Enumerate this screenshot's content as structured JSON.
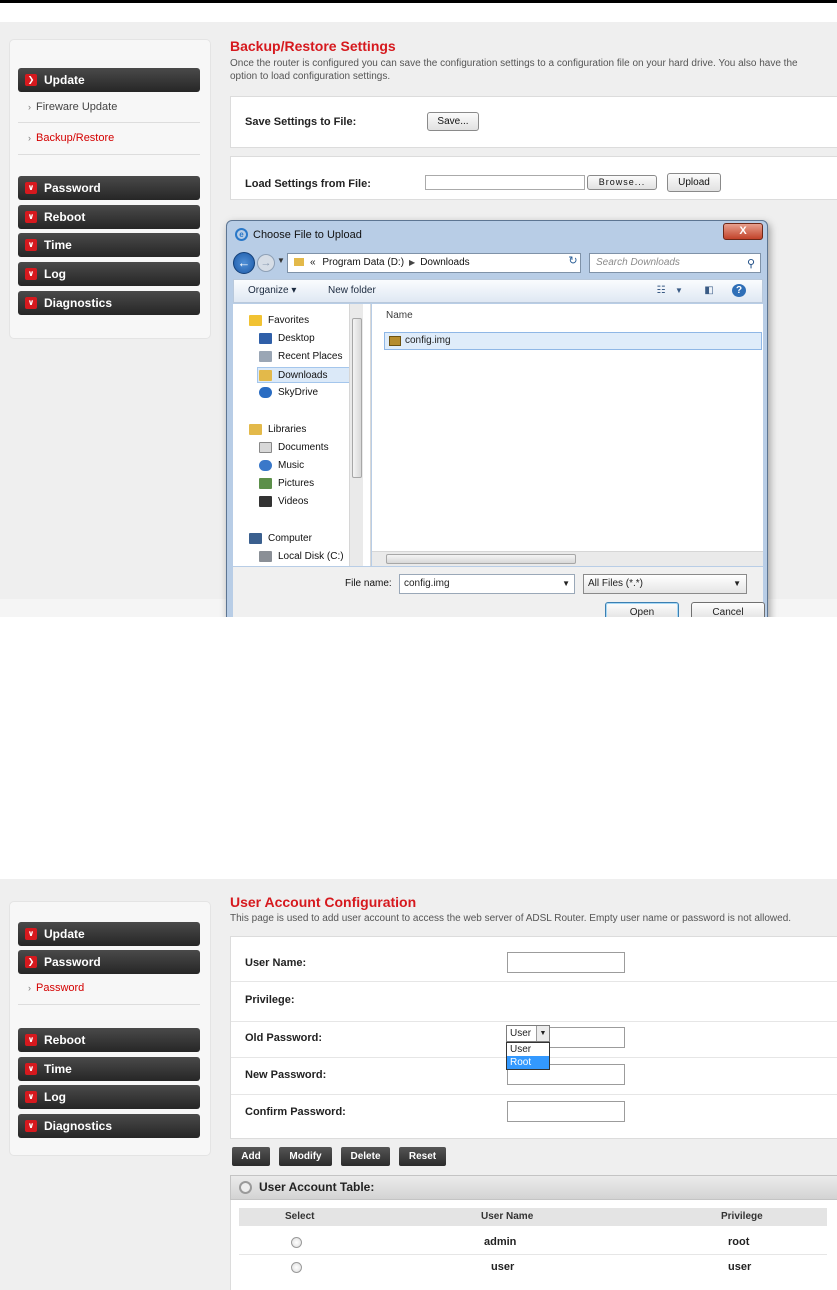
{
  "backup": {
    "sidebar": {
      "update": "Update",
      "firmware_update": "Fireware Update",
      "backup_restore": "Backup/Restore",
      "password": "Password",
      "reboot": "Reboot",
      "time": "Time",
      "log": "Log",
      "diagnostics": "Diagnostics"
    },
    "title": "Backup/Restore Settings",
    "description": "Once the router is configured you can save the configuration settings to a configuration file on your hard drive. You also have the option to load configuration settings.",
    "save_label": "Save Settings to File:",
    "save_button": "Save...",
    "load_label": "Load Settings from File:",
    "browse_button": "Browse...",
    "upload_button": "Upload",
    "dialog": {
      "title": "Choose File to Upload",
      "close": "X",
      "breadcrumb_prefix": "«",
      "breadcrumb_drive": "Program Data (D:)",
      "breadcrumb_folder": "Downloads",
      "search_placeholder": "Search Downloads",
      "organize": "Organize ▾",
      "new_folder": "New folder",
      "favorites": "Favorites",
      "desktop": "Desktop",
      "recent_places": "Recent Places",
      "downloads": "Downloads",
      "skydrive": "SkyDrive",
      "libraries": "Libraries",
      "documents": "Documents",
      "music": "Music",
      "pictures": "Pictures",
      "videos": "Videos",
      "computer": "Computer",
      "local_disk": "Local Disk (C:)",
      "column_name": "Name",
      "file_item": "config.img",
      "file_name_label": "File name:",
      "file_name_value": "config.img",
      "file_type": "All Files (*.*)",
      "open_button": "Open",
      "cancel_button": "Cancel"
    }
  },
  "account": {
    "sidebar": {
      "update": "Update",
      "password": "Password",
      "password_sub": "Password",
      "reboot": "Reboot",
      "time": "Time",
      "log": "Log",
      "diagnostics": "Diagnostics"
    },
    "title": "User Account Configuration",
    "description": "This page is used to add user account to access the web server of ADSL Router. Empty user name or password is not allowed.",
    "fields": {
      "user_name": "User Name:",
      "privilege": "Privilege:",
      "old_password": "Old Password:",
      "new_password": "New Password:",
      "confirm_password": "Confirm Password:"
    },
    "privilege_selected": "User",
    "privilege_options": [
      "User",
      "Root"
    ],
    "buttons": {
      "add": "Add",
      "modify": "Modify",
      "delete": "Delete",
      "reset": "Reset"
    },
    "table_title": "User Account Table:",
    "table_headers": [
      "Select",
      "User Name",
      "Privilege"
    ],
    "rows": [
      {
        "user": "admin",
        "privilege": "root"
      },
      {
        "user": "user",
        "privilege": "user"
      }
    ]
  },
  "colors": {
    "accent": "#d6191e",
    "nav_dark": "#2e2e2e",
    "selection": "#3399ff"
  }
}
